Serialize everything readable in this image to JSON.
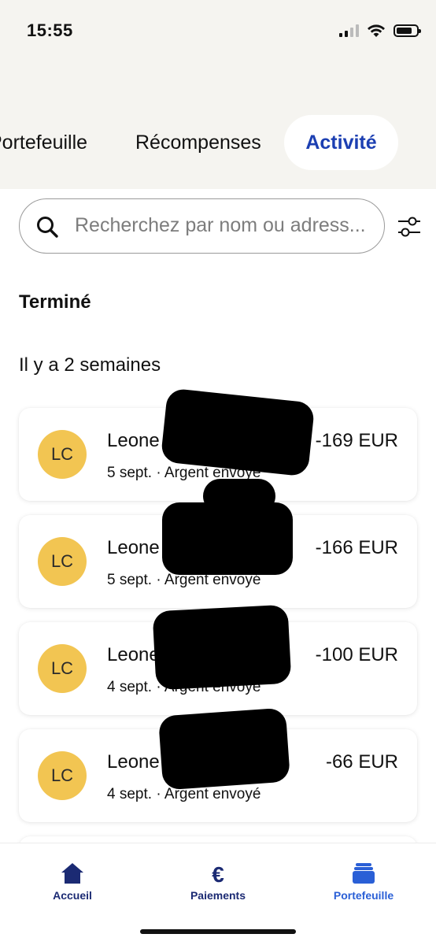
{
  "status_bar": {
    "time": "15:55"
  },
  "tabs": [
    {
      "label": "Portefeuille",
      "active": false
    },
    {
      "label": "Récompenses",
      "active": false
    },
    {
      "label": "Activité",
      "active": true
    }
  ],
  "search": {
    "placeholder": "Recherchez par nom ou adress...",
    "value": ""
  },
  "section_title": "Terminé",
  "group_title": "Il y a 2 semaines",
  "transactions": [
    {
      "initials": "LC",
      "name": "Leone C",
      "date": "5 sept.",
      "type": "Argent envoyé",
      "amount": "-169 EUR"
    },
    {
      "initials": "LC",
      "name": "Leone C",
      "date": "5 sept.",
      "type": "Argent envoyé",
      "amount": "-166 EUR"
    },
    {
      "initials": "LC",
      "name": "Leone",
      "date": "4 sept.",
      "type": "Argent envoyé",
      "amount": "-100 EUR"
    },
    {
      "initials": "LC",
      "name": "Leone C",
      "date": "4 sept.",
      "type": "Argent envoyé",
      "amount": "-66 EUR"
    }
  ],
  "meta_separator": " · ",
  "bottom_nav": [
    {
      "label": "Accueil",
      "icon": "home-icon",
      "active": false
    },
    {
      "label": "Paiements",
      "icon": "euro-icon",
      "active": false
    },
    {
      "label": "Portefeuille",
      "icon": "wallet-icon",
      "active": true
    }
  ],
  "colors": {
    "accent": "#1c3fb2",
    "nav_dark": "#1b2a73",
    "nav_active": "#2a5fd6",
    "avatar": "#f2c552",
    "header_bg": "#f5f4f0"
  }
}
